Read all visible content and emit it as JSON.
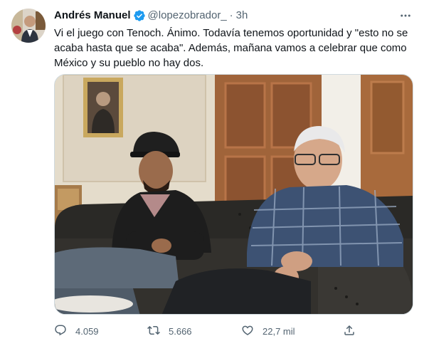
{
  "tweet": {
    "author_name": "Andrés Manuel",
    "handle": "@lopezobrador_",
    "separator": "·",
    "time": "3h",
    "text": "Vi el juego con Tenoch. Ánimo. Todavía tenemos oportunidad y \"esto no se acaba hasta que se acaba\". Además, mañana vamos a celebrar que como México y su pueblo no hay dos.",
    "verified": true
  },
  "actions": {
    "replies": "4.059",
    "retweets": "5.666",
    "likes": "22,7 mil"
  },
  "icons": {
    "verified": "verified-badge-icon",
    "more": "more-dots-icon",
    "reply": "reply-icon",
    "retweet": "retweet-icon",
    "like": "heart-icon",
    "share": "share-icon"
  },
  "colors": {
    "verified_blue": "#1d9bf0",
    "secondary_text": "#536471",
    "primary_text": "#0f1419"
  }
}
